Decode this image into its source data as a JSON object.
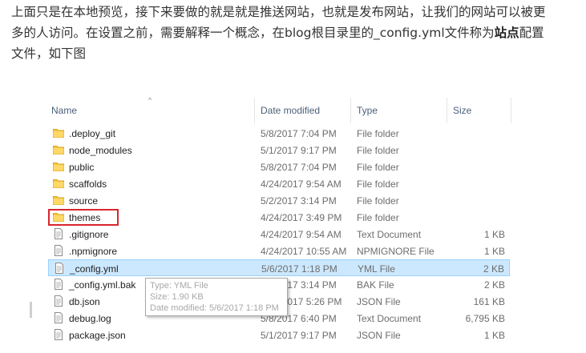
{
  "article": {
    "line1": "上面只是在本地预览，接下来要做的就是就是推送网站，也就是发布网站，让我们的网站可以被更",
    "line2_before": "多的人访问。在设置之前，需要解释一个概念，在blog根目录里的_config.yml文件称为",
    "line2_bold": "站点",
    "line2_after": "配置",
    "line3": "文件，如下图"
  },
  "explorer": {
    "columns": {
      "name": "Name",
      "date": "Date modified",
      "type": "Type",
      "size": "Size"
    },
    "sort_indicator": "^",
    "rows": [
      {
        "name": ".deploy_git",
        "date": "5/8/2017 7:04 PM",
        "type": "File folder",
        "size": "",
        "icon": "folder-icon"
      },
      {
        "name": "node_modules",
        "date": "5/1/2017 9:17 PM",
        "type": "File folder",
        "size": "",
        "icon": "folder-icon"
      },
      {
        "name": "public",
        "date": "5/8/2017 7:04 PM",
        "type": "File folder",
        "size": "",
        "icon": "folder-icon"
      },
      {
        "name": "scaffolds",
        "date": "4/24/2017 9:54 AM",
        "type": "File folder",
        "size": "",
        "icon": "folder-icon"
      },
      {
        "name": "source",
        "date": "5/2/2017 3:14 PM",
        "type": "File folder",
        "size": "",
        "icon": "folder-icon"
      },
      {
        "name": "themes",
        "date": "4/24/2017 3:49 PM",
        "type": "File folder",
        "size": "",
        "icon": "folder-icon"
      },
      {
        "name": ".gitignore",
        "date": "4/24/2017 9:54 AM",
        "type": "Text Document",
        "size": "1 KB",
        "icon": "file-icon"
      },
      {
        "name": ".npmignore",
        "date": "4/24/2017 10:55 AM",
        "type": "NPMIGNORE File",
        "size": "1 KB",
        "icon": "file-icon"
      },
      {
        "name": "_config.yml",
        "date": "5/6/2017 1:18 PM",
        "type": "YML File",
        "size": "2 KB",
        "icon": "file-icon"
      },
      {
        "name": "_config.yml.bak",
        "date": "5/2/2017 3:14 PM",
        "type": "BAK File",
        "size": "2 KB",
        "icon": "file-icon"
      },
      {
        "name": "db.json",
        "date": "5/12/2017 5:26 PM",
        "type": "JSON File",
        "size": "161 KB",
        "icon": "file-icon"
      },
      {
        "name": "debug.log",
        "date": "5/8/2017 6:40 PM",
        "type": "Text Document",
        "size": "6,795 KB",
        "icon": "file-icon"
      },
      {
        "name": "package.json",
        "date": "5/1/2017 9:17 PM",
        "type": "JSON File",
        "size": "1 KB",
        "icon": "file-icon"
      }
    ],
    "tooltip": {
      "type": "Type: YML File",
      "size": "Size: 1.90 KB",
      "date": "Date modified: 5/6/2017 1:18 PM"
    },
    "colors": {
      "selection": "#cce8ff",
      "callout": "#d9272e",
      "folder": "#f5c842"
    }
  }
}
